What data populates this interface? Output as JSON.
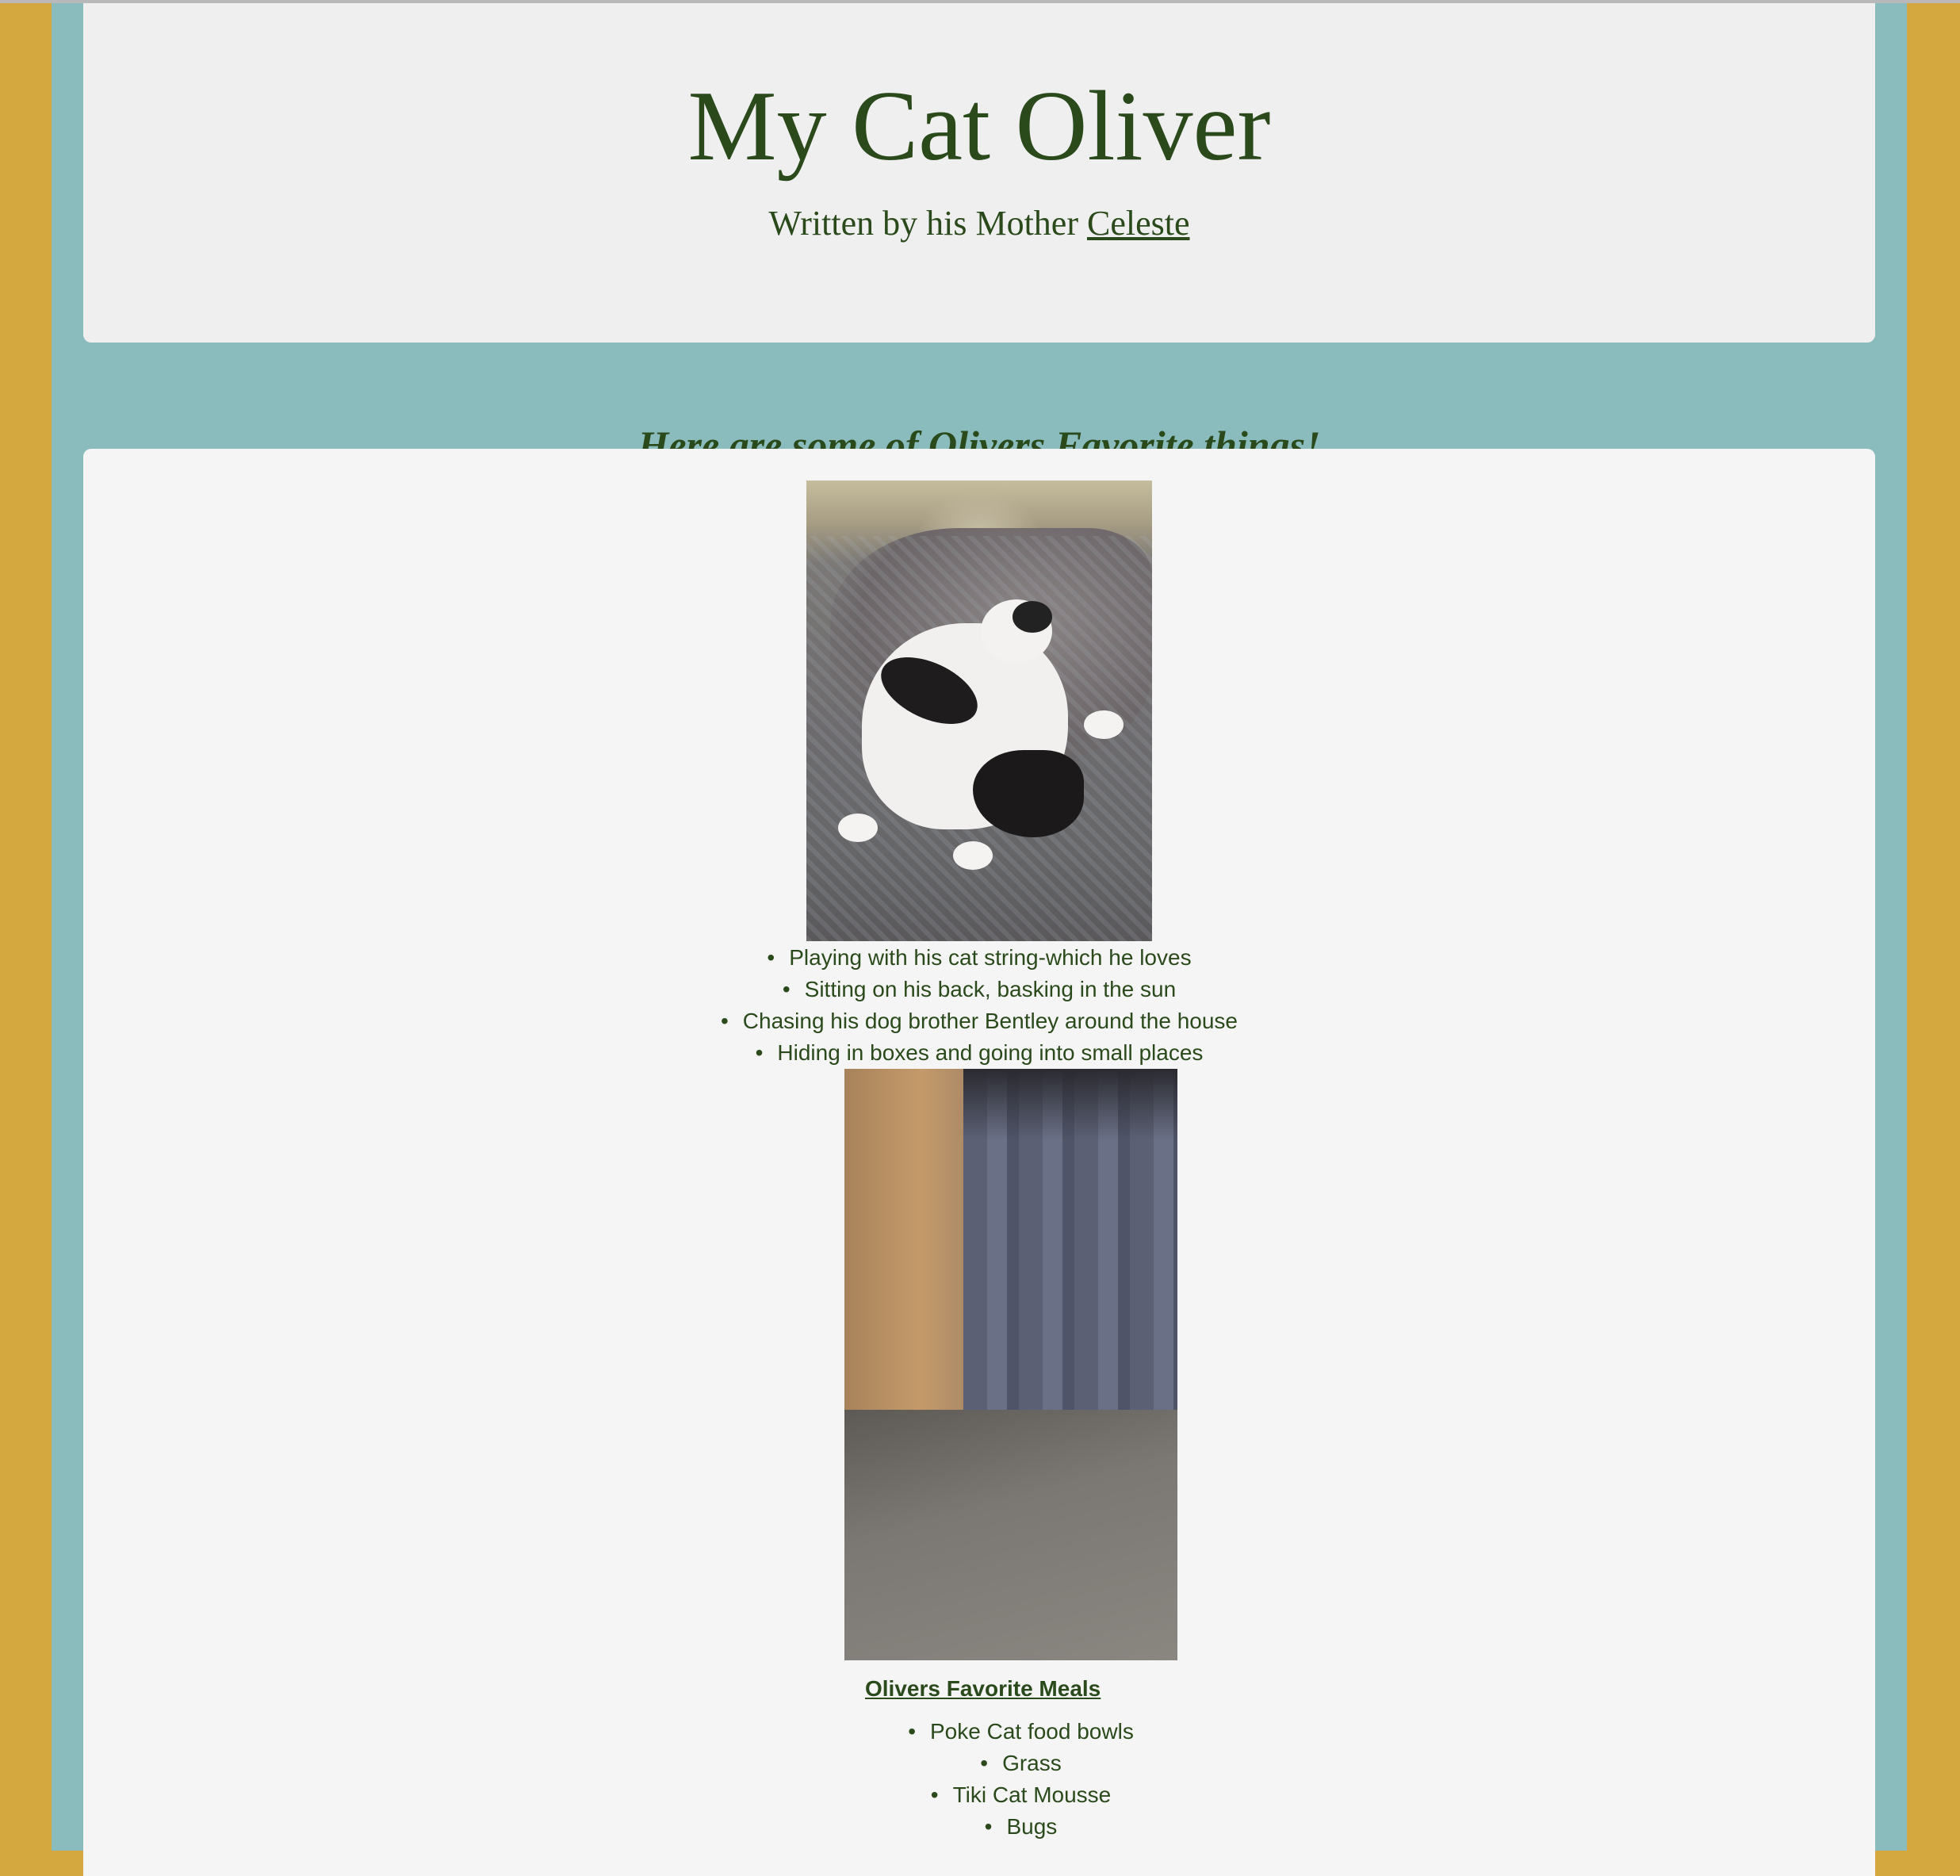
{
  "header": {
    "title": "My Cat Oliver",
    "byline_prefix": "Written by his Mother",
    "byline_link": "Celeste"
  },
  "favorites": {
    "heading_before": "Here are some of Olivers",
    "heading_emphasis": "Favorite",
    "heading_after": "things!",
    "items": [
      "Playing with his cat string-which he loves",
      "Sitting on his back, basking in the sun",
      "Chasing his dog brother Bentley around the house",
      "Hiding in boxes and going into small places"
    ]
  },
  "meals": {
    "heading": "Olivers Favorite Meals",
    "items": [
      "Poke Cat food bowls",
      "Grass",
      "Tiki Cat Mousse",
      "Bugs"
    ]
  },
  "colors": {
    "page_border": "#d4a83f",
    "teal_background": "#8abcbd",
    "card_background": "#f5f5f5",
    "text": "#2b4a1c"
  }
}
